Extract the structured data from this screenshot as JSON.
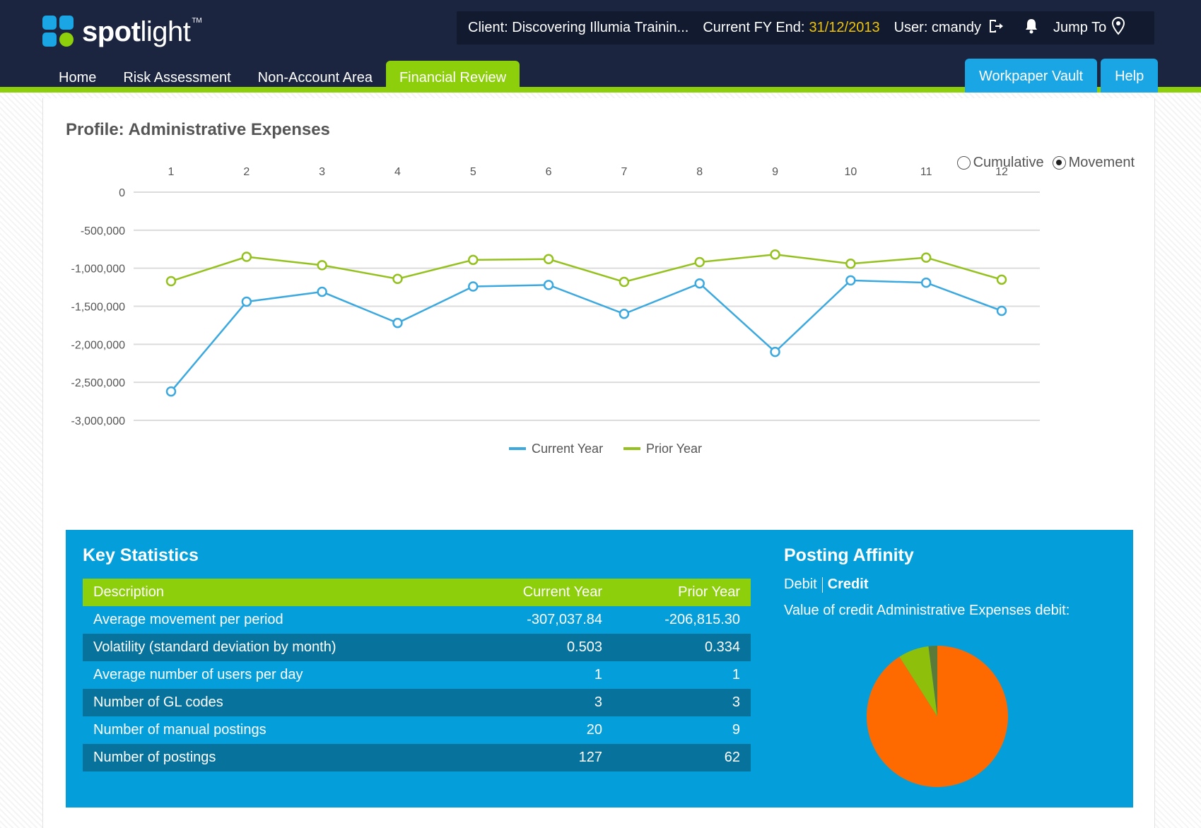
{
  "header": {
    "logo_text_bold": "spot",
    "logo_text_light": "light",
    "logo_tm": "TM",
    "client": "Client: Discovering Illumia Trainin...",
    "fy_label": "Current FY End:",
    "fy_date": "31/12/2013",
    "user": "User: cmandy",
    "jump_to": "Jump To",
    "tabs": [
      "Home",
      "Risk Assessment",
      "Non-Account Area",
      "Financial Review"
    ],
    "active_tab": "Financial Review",
    "right_buttons": [
      "Workpaper Vault",
      "Help"
    ],
    "icons": [
      "logout-icon",
      "bell-icon",
      "map-pin-icon"
    ]
  },
  "profile": {
    "title": "Profile: Administrative Expenses",
    "radio_cumulative": "Cumulative",
    "radio_movement": "Movement",
    "selected": "Movement"
  },
  "chart_data": {
    "type": "line",
    "x": [
      1,
      2,
      3,
      4,
      5,
      6,
      7,
      8,
      9,
      10,
      11,
      12
    ],
    "x_tick_labels": [
      "1",
      "2",
      "3",
      "4",
      "5",
      "6",
      "7",
      "8",
      "9",
      "10",
      "11",
      "12"
    ],
    "y_tick_labels": [
      "0",
      "-500,000",
      "-1,000,000",
      "-1,500,000",
      "-2,000,000",
      "-2,500,000",
      "-3,000,000"
    ],
    "y_ticks": [
      0,
      -500000,
      -1000000,
      -1500000,
      -2000000,
      -2500000,
      -3000000
    ],
    "ylim": [
      -3000000,
      0
    ],
    "x_axis_position": "top",
    "grid": true,
    "legend": "bottom-center",
    "series": [
      {
        "name": "Current Year",
        "color": "#3ba9e0",
        "values": [
          -2620000,
          -1440000,
          -1310000,
          -1720000,
          -1240000,
          -1220000,
          -1600000,
          -1200000,
          -2100000,
          -1160000,
          -1190000,
          -1560000
        ]
      },
      {
        "name": "Prior Year",
        "color": "#95c11f",
        "values": [
          -1170000,
          -850000,
          -960000,
          -1140000,
          -890000,
          -880000,
          -1180000,
          -920000,
          -820000,
          -940000,
          -860000,
          -1150000
        ]
      }
    ]
  },
  "key_statistics": {
    "title": "Key Statistics",
    "headers": [
      "Description",
      "Current Year",
      "Prior Year"
    ],
    "rows": [
      [
        "Average movement per period",
        "-307,037.84",
        "-206,815.30"
      ],
      [
        "Volatility (standard deviation by month)",
        "0.503",
        "0.334"
      ],
      [
        "Average number of users per day",
        "1",
        "1"
      ],
      [
        "Number of GL codes",
        "3",
        "3"
      ],
      [
        "Number of manual postings",
        "20",
        "9"
      ],
      [
        "Number of postings",
        "127",
        "62"
      ]
    ]
  },
  "posting_affinity": {
    "title": "Posting Affinity",
    "link_debit": "Debit",
    "link_credit": "Credit",
    "selected": "Credit",
    "caption": "Value of credit Administrative Expenses debit:",
    "pie": {
      "type": "pie",
      "slices": [
        {
          "fraction": 0.91,
          "color": "#ff6a00"
        },
        {
          "fraction": 0.07,
          "color": "#8dbf0b"
        },
        {
          "fraction": 0.02,
          "color": "#5a7a3a"
        }
      ]
    }
  }
}
